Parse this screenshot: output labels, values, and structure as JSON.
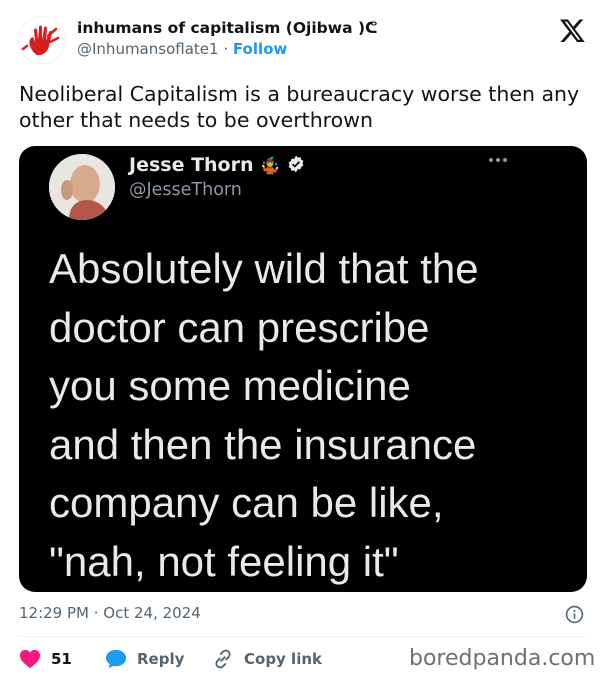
{
  "author": {
    "name": "inhumans of capitalism (Ojibwa )ᕦ",
    "handle": "@Inhumansoflate1",
    "separator": "·",
    "follow_label": "Follow"
  },
  "tweet": {
    "text": "Neoliberal Capitalism is a bureaucracy worse then any other that needs to be overthrown"
  },
  "embedded": {
    "name": "Jesse Thorn",
    "handle": "@JesseThorn",
    "text": "Absolutely wild that the\ndoctor can prescribe\nyou some medicine\nand then the insurance\ncompany can be like,\n\"nah, not feeling it\""
  },
  "meta": {
    "timestamp": "12:29 PM · Oct 24, 2024"
  },
  "actions": {
    "likes": "51",
    "reply_label": "Reply",
    "copy_label": "Copy link"
  },
  "watermark": "boredpanda.com",
  "colors": {
    "accent": "#1d9bf0",
    "like": "#f91880",
    "media_bg": "#000000",
    "text": "#0f1419",
    "muted": "#536471"
  }
}
